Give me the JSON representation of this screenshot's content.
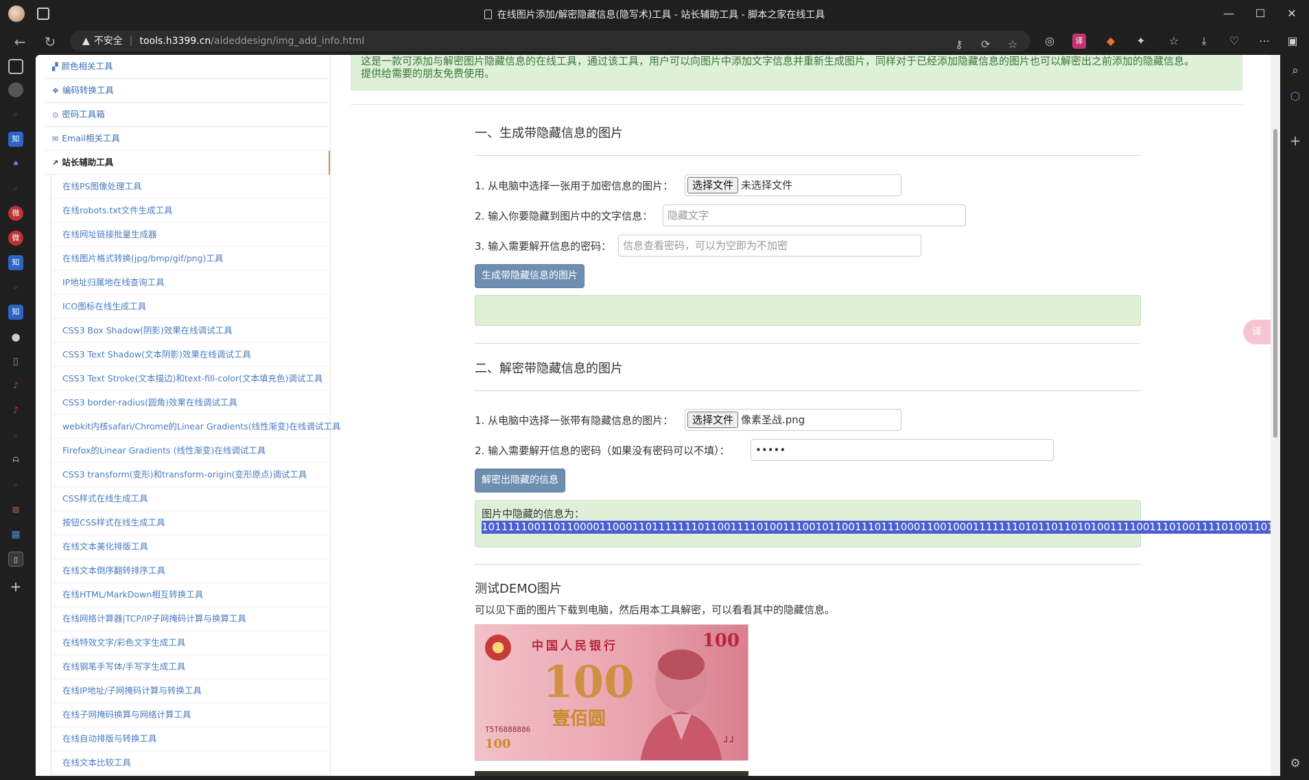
{
  "window": {
    "title": "在线图片添加/解密隐藏信息(隐写术)工具 - 站长辅助工具 - 脚本之家在线工具",
    "controls": {
      "minimize": "—",
      "maximize": "☐",
      "close": "✕"
    }
  },
  "address_bar": {
    "security_label": "不安全",
    "host": "tools.h3399.cn",
    "path": "/aideddesign/img_add_info.html"
  },
  "sidebar": {
    "top_items": [
      {
        "icon": "palette-icon",
        "label": "颜色相关工具"
      },
      {
        "icon": "cubes-icon",
        "label": "编码转换工具"
      },
      {
        "icon": "lock-icon",
        "label": "密码工具箱"
      },
      {
        "icon": "envelope-icon",
        "label": "Email相关工具"
      }
    ],
    "active_item": {
      "icon": "external-link-icon",
      "label": "站长辅助工具"
    },
    "sub_items": [
      "在线PS图像处理工具",
      "在线robots.txt文件生成工具",
      "在线网址链接批量生成器",
      "在线图片格式转换(jpg/bmp/gif/png)工具",
      "IP地址归属地在线查询工具",
      "ICO图标在线生成工具",
      "CSS3 Box Shadow(阴影)效果在线调试工具",
      "CSS3 Text Shadow(文本阴影)效果在线调试工具",
      "CSS3 Text Stroke(文本描边)和text-fill-color(文本填充色)调试工具",
      "CSS3 border-radius(圆角)效果在线调试工具",
      "webkit内核safari/Chrome的Linear Gradients(线性渐变)在线调试工具",
      "Firefox的Linear Gradients (线性渐变)在线调试工具",
      "CSS3 transform(变形)和transform-origin(变形原点)调试工具",
      "CSS样式在线生成工具",
      "按钮CSS样式在线生成工具",
      "在线文本美化排版工具",
      "在线文本倒序翻转排序工具",
      "在线HTML/MarkDown相互转换工具",
      "在线网络计算器|TCP/IP子网掩码计算与换算工具",
      "在线特效文字/彩色文字生成工具",
      "在线钢笔手写体/手写字生成工具",
      "在线IP地址/子网掩码计算与转换工具",
      "在线子网掩码换算与网络计算工具",
      "在线自动排版与转换工具",
      "在线文本比较工具"
    ]
  },
  "main": {
    "intro_line1": "这是一款可添加与解密图片隐藏信息的在线工具，通过该工具，用户可以向图片中添加文字信息并重新生成图片，同样对于已经添加隐藏信息的图片也可以解密出之前添加的隐藏信息。",
    "intro_line2": "提供给需要的朋友免费使用。",
    "encode": {
      "title": "一、生成带隐藏信息的图片",
      "step1_label": "1. 从电脑中选择一张用于加密信息的图片：",
      "step1_button": "选择文件",
      "step1_file": "未选择文件",
      "step2_label": "2. 输入你要隐藏到图片中的文字信息：",
      "step2_placeholder": "隐藏文字",
      "step3_label": "3. 输入需要解开信息的密码：",
      "step3_placeholder": "信息查看密码，可以为空即为不加密",
      "submit": "生成带隐藏信息的图片"
    },
    "decode": {
      "title": "二、解密带隐藏信息的图片",
      "step1_label": "1. 从电脑中选择一张带有隐藏信息的图片：",
      "step1_button": "选择文件",
      "step1_file": "像素圣战.png",
      "step2_label": "2. 输入需要解开信息的密码（如果没有密码可以不填）：",
      "step2_value": "•••••",
      "submit": "解密出隐藏的信息",
      "result_label": "图片中隐藏的信息为：",
      "result_value": "10111110011011000011000110111111101100111101001110010110011101110001100100011111110101101101010011110011101001111010011011"
    },
    "demo": {
      "title": "测试DEMO图片",
      "desc": "可以见下面的图片下载到电脑，然后用本工具解密，可以看看其中的隐藏信息。",
      "note_bank": "中国人民银行",
      "note_value": "100",
      "note_yuan": "壹佰圆",
      "note_serial": "T5T6888886"
    }
  }
}
